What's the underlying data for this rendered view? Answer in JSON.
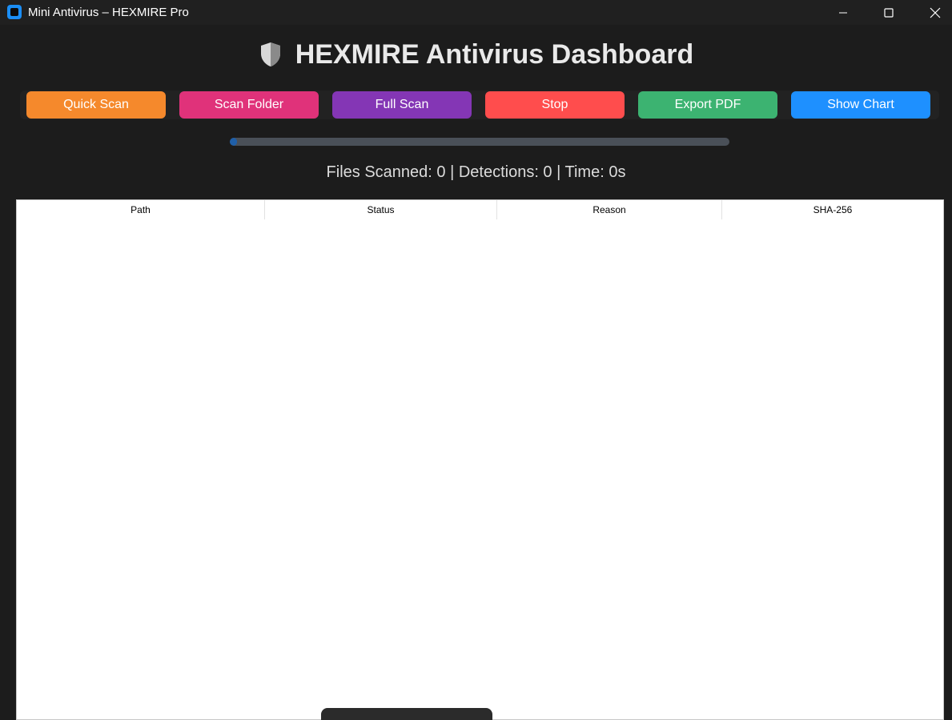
{
  "window": {
    "title": "Mini Antivirus – HEXMIRE Pro",
    "icon": "app-icon",
    "controls": [
      "minimize-icon",
      "maximize-icon",
      "close-icon"
    ]
  },
  "header": {
    "icon": "shield-icon",
    "title": "HEXMIRE Antivirus Dashboard"
  },
  "toolbar": {
    "quick_scan": "Quick Scan",
    "scan_folder": "Scan Folder",
    "full_scan": "Full Scan",
    "stop": "Stop",
    "export_pdf": "Export PDF",
    "show_chart": "Show Chart",
    "colors": {
      "quick_scan": "#f5892c",
      "scan_folder": "#e0327a",
      "full_scan": "#8436b5",
      "stop": "#ff4d4d",
      "export_pdf": "#3cb371",
      "show_chart": "#1e90ff"
    }
  },
  "progress": {
    "fraction": 0.015
  },
  "stats": {
    "text": "Files Scanned: 0 | Detections: 0 | Time: 0s"
  },
  "table": {
    "columns": [
      "Path",
      "Status",
      "Reason",
      "SHA-256"
    ],
    "rows": []
  }
}
